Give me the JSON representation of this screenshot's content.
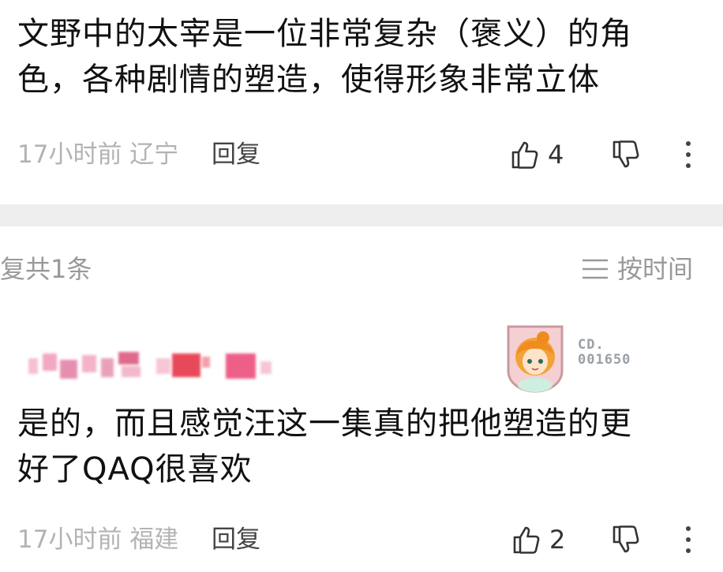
{
  "comment1": {
    "text_line1": "文野中的太宰是一位非常复杂（褒义）的角",
    "text_line2": "色，各种剧情的塑造，使得形象非常立体",
    "time": "17小时前 辽宁",
    "reply_label": "回复",
    "like_count": "4",
    "icons": [
      "thumbs-up-icon",
      "thumbs-down-icon",
      "more-icon"
    ]
  },
  "replies": {
    "count_label": "复共1条",
    "sort_label": "按时间",
    "sort_icon": "list-icon"
  },
  "reply1": {
    "badge_line1": "CD.",
    "badge_line2": "001650",
    "text_line1": "是的，而且感觉汪这一集真的把他塑造的更",
    "text_line2": "好了QAQ很喜欢",
    "time": "17小时前 福建",
    "reply_label": "回复",
    "like_count": "2",
    "icons": [
      "thumbs-up-icon",
      "thumbs-down-icon",
      "more-icon"
    ]
  },
  "colors": {
    "divider": "#eeeeef",
    "muted_text": "#b3b3b3",
    "username_blur": [
      "#f2a7c3",
      "#e06a8c",
      "#e84a5a",
      "#f7c6d6"
    ]
  }
}
